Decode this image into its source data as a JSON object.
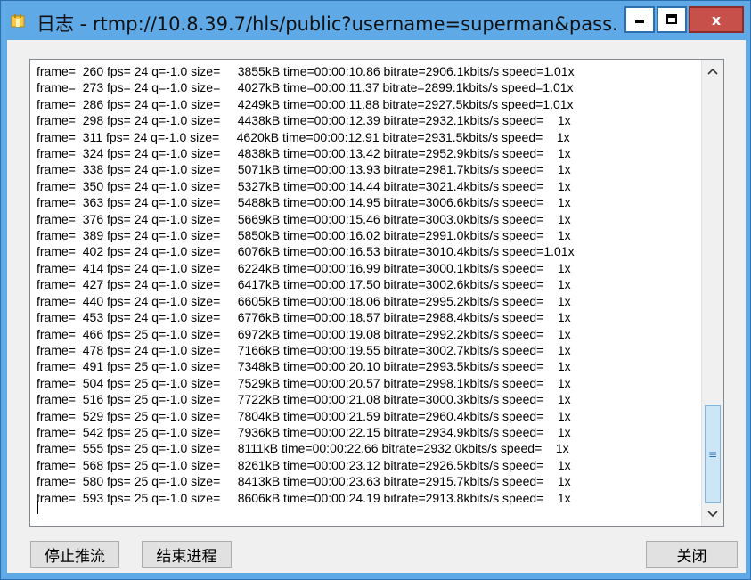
{
  "window": {
    "title": "日志 - rtmp://10.8.39.7/hls/public?username=superman&pass...",
    "controls": {
      "minimize": "—",
      "maximize": "□",
      "close": "x"
    },
    "accent_color": "#5fa9e6",
    "close_color": "#c7504a"
  },
  "log": {
    "lines": [
      "frame=  260 fps= 24 q=-1.0 size=     3855kB time=00:00:10.86 bitrate=2906.1kbits/s speed=1.01x",
      "frame=  273 fps= 24 q=-1.0 size=     4027kB time=00:00:11.37 bitrate=2899.1kbits/s speed=1.01x",
      "frame=  286 fps= 24 q=-1.0 size=     4249kB time=00:00:11.88 bitrate=2927.5kbits/s speed=1.01x",
      "frame=  298 fps= 24 q=-1.0 size=     4438kB time=00:00:12.39 bitrate=2932.1kbits/s speed=    1x",
      "frame=  311 fps= 24 q=-1.0 size=     4620kB time=00:00:12.91 bitrate=2931.5kbits/s speed=    1x",
      "frame=  324 fps= 24 q=-1.0 size=     4838kB time=00:00:13.42 bitrate=2952.9kbits/s speed=    1x",
      "frame=  338 fps= 24 q=-1.0 size=     5071kB time=00:00:13.93 bitrate=2981.7kbits/s speed=    1x",
      "frame=  350 fps= 24 q=-1.0 size=     5327kB time=00:00:14.44 bitrate=3021.4kbits/s speed=    1x",
      "frame=  363 fps= 24 q=-1.0 size=     5488kB time=00:00:14.95 bitrate=3006.6kbits/s speed=    1x",
      "frame=  376 fps= 24 q=-1.0 size=     5669kB time=00:00:15.46 bitrate=3003.0kbits/s speed=    1x",
      "frame=  389 fps= 24 q=-1.0 size=     5850kB time=00:00:16.02 bitrate=2991.0kbits/s speed=    1x",
      "frame=  402 fps= 24 q=-1.0 size=     6076kB time=00:00:16.53 bitrate=3010.4kbits/s speed=1.01x",
      "frame=  414 fps= 24 q=-1.0 size=     6224kB time=00:00:16.99 bitrate=3000.1kbits/s speed=    1x",
      "frame=  427 fps= 24 q=-1.0 size=     6417kB time=00:00:17.50 bitrate=3002.6kbits/s speed=    1x",
      "frame=  440 fps= 24 q=-1.0 size=     6605kB time=00:00:18.06 bitrate=2995.2kbits/s speed=    1x",
      "frame=  453 fps= 24 q=-1.0 size=     6776kB time=00:00:18.57 bitrate=2988.4kbits/s speed=    1x",
      "frame=  466 fps= 25 q=-1.0 size=     6972kB time=00:00:19.08 bitrate=2992.2kbits/s speed=    1x",
      "frame=  478 fps= 24 q=-1.0 size=     7166kB time=00:00:19.55 bitrate=3002.7kbits/s speed=    1x",
      "frame=  491 fps= 25 q=-1.0 size=     7348kB time=00:00:20.10 bitrate=2993.5kbits/s speed=    1x",
      "frame=  504 fps= 25 q=-1.0 size=     7529kB time=00:00:20.57 bitrate=2998.1kbits/s speed=    1x",
      "frame=  516 fps= 25 q=-1.0 size=     7722kB time=00:00:21.08 bitrate=3000.3kbits/s speed=    1x",
      "frame=  529 fps= 25 q=-1.0 size=     7804kB time=00:00:21.59 bitrate=2960.4kbits/s speed=    1x",
      "frame=  542 fps= 25 q=-1.0 size=     7936kB time=00:00:22.15 bitrate=2934.9kbits/s speed=    1x",
      "frame=  555 fps= 25 q=-1.0 size=     8111kB time=00:00:22.66 bitrate=2932.0kbits/s speed=    1x",
      "frame=  568 fps= 25 q=-1.0 size=     8261kB time=00:00:23.12 bitrate=2926.5kbits/s speed=    1x",
      "frame=  580 fps= 25 q=-1.0 size=     8413kB time=00:00:23.63 bitrate=2915.7kbits/s speed=    1x",
      "frame=  593 fps= 25 q=-1.0 size=     8606kB time=00:00:24.19 bitrate=2913.8kbits/s speed=    1x"
    ],
    "scrollbar": {
      "up_glyph": "^",
      "down_glyph": "v",
      "thumb_glyph": "≡"
    }
  },
  "buttons": {
    "stop_push": "停止推流",
    "end_process": "结束进程",
    "close": "关闭"
  }
}
